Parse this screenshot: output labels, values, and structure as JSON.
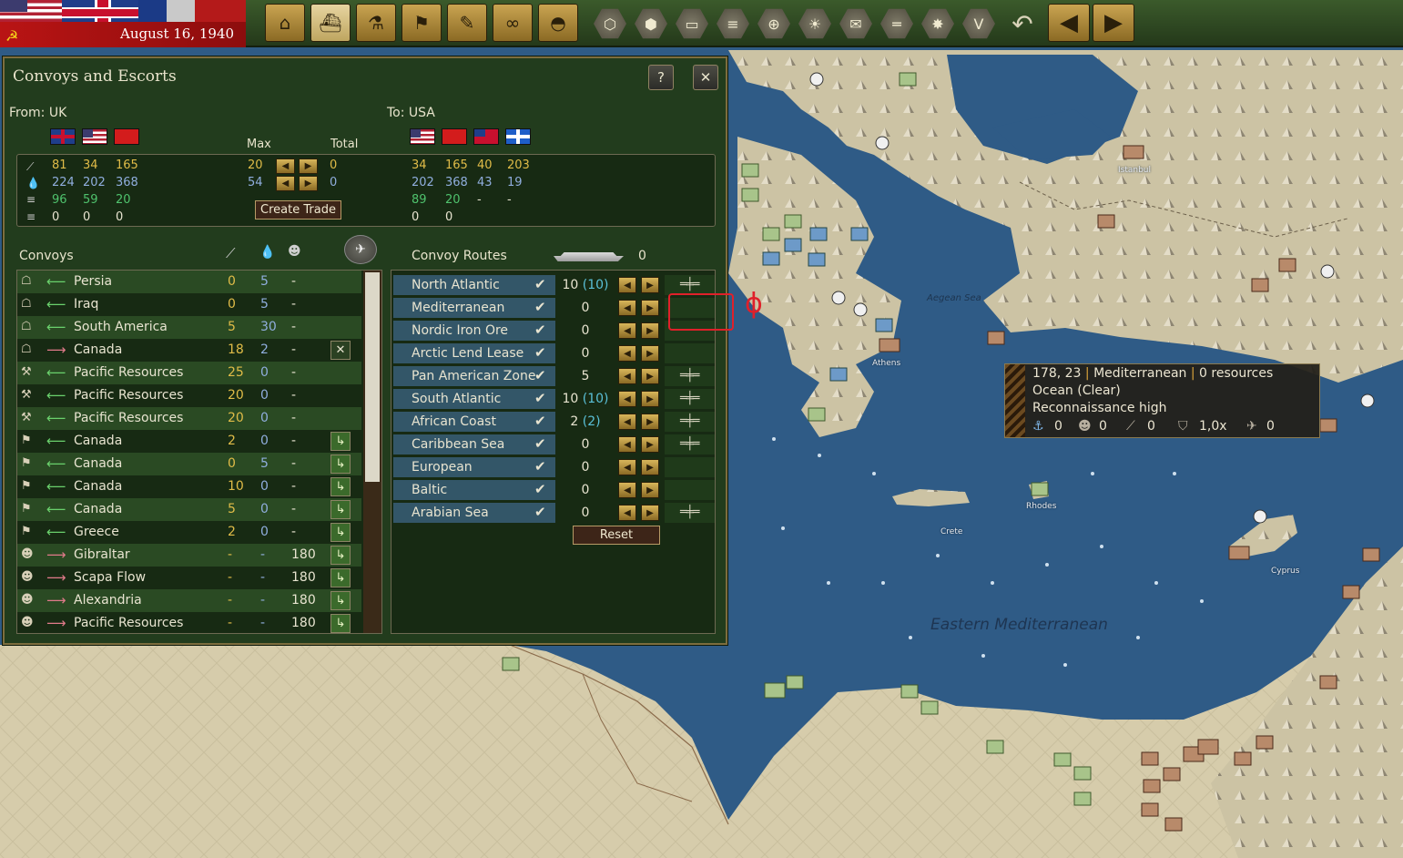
{
  "topbar": {
    "date": "August 16, 1940",
    "buttons": [
      "factory-icon",
      "ship-icon",
      "research-icon",
      "flag-icon",
      "report-icon",
      "binoculars-icon",
      "helmet-icon"
    ],
    "hex_buttons": [
      "hex-grid-icon",
      "hex-cluster-icon",
      "tank-icon",
      "supply-icon",
      "target-icon",
      "sun-icon",
      "mail-icon",
      "convoy-icon",
      "explosion-icon"
    ],
    "v_label": "V",
    "undo_icon": "↶",
    "prev_icon": "◀",
    "next_icon": "▶"
  },
  "dialog": {
    "title": "Convoys and Escorts",
    "help_label": "?",
    "close_label": "✕",
    "from_label": "From: UK",
    "to_label": "To: USA",
    "max_label": "Max",
    "total_label": "Total",
    "create_trade_label": "Create Trade",
    "trade": {
      "from_rows": [
        [
          "81",
          "34",
          "165"
        ],
        [
          "224",
          "202",
          "368"
        ],
        [
          "96",
          "59",
          "20"
        ],
        [
          "0",
          "0",
          "0"
        ]
      ],
      "max": [
        "20",
        "54"
      ],
      "total": [
        "0",
        "0"
      ],
      "to_rows": [
        [
          "34",
          "165",
          "40",
          "203"
        ],
        [
          "202",
          "368",
          "43",
          "19"
        ],
        [
          "89",
          "20",
          "-",
          "-"
        ],
        [
          "0",
          "0",
          "",
          ""
        ]
      ]
    },
    "convoys_label": "Convoys",
    "convoy_routes_label": "Convoy Routes",
    "convoy_routes_count": "0",
    "convoys": [
      {
        "icon": "trade",
        "dir": "left",
        "name": "Persia",
        "c1": "0",
        "c2": "5",
        "c3": "-",
        "action": ""
      },
      {
        "icon": "trade",
        "dir": "left",
        "name": "Iraq",
        "c1": "0",
        "c2": "5",
        "c3": "-",
        "action": ""
      },
      {
        "icon": "trade",
        "dir": "left",
        "name": "South America",
        "c1": "5",
        "c2": "30",
        "c3": "-",
        "action": ""
      },
      {
        "icon": "trade",
        "dir": "right",
        "name": "Canada",
        "c1": "18",
        "c2": "2",
        "c3": "-",
        "action": "✕"
      },
      {
        "icon": "tools",
        "dir": "left",
        "name": "Pacific Resources",
        "c1": "25",
        "c2": "0",
        "c3": "-",
        "action": ""
      },
      {
        "icon": "tools",
        "dir": "left",
        "name": "Pacific Resources",
        "c1": "20",
        "c2": "0",
        "c3": "-",
        "action": ""
      },
      {
        "icon": "tools",
        "dir": "left",
        "name": "Pacific Resources",
        "c1": "20",
        "c2": "0",
        "c3": "-",
        "action": ""
      },
      {
        "icon": "flag",
        "dir": "left",
        "name": "Canada",
        "c1": "2",
        "c2": "0",
        "c3": "-",
        "action": "↳"
      },
      {
        "icon": "flag",
        "dir": "left",
        "name": "Canada",
        "c1": "0",
        "c2": "5",
        "c3": "-",
        "action": "↳"
      },
      {
        "icon": "flag",
        "dir": "left",
        "name": "Canada",
        "c1": "10",
        "c2": "0",
        "c3": "-",
        "action": "↳"
      },
      {
        "icon": "flag",
        "dir": "left",
        "name": "Canada",
        "c1": "5",
        "c2": "0",
        "c3": "-",
        "action": "↳"
      },
      {
        "icon": "flag",
        "dir": "left",
        "name": "Greece",
        "c1": "2",
        "c2": "0",
        "c3": "-",
        "action": "↳"
      },
      {
        "icon": "soldier",
        "dir": "right",
        "name": "Gibraltar",
        "c1": "-",
        "c2": "-",
        "c3": "180",
        "action": "↳"
      },
      {
        "icon": "soldier",
        "dir": "right",
        "name": "Scapa Flow",
        "c1": "-",
        "c2": "-",
        "c3": "180",
        "action": "↳"
      },
      {
        "icon": "soldier",
        "dir": "right",
        "name": "Alexandria",
        "c1": "-",
        "c2": "-",
        "c3": "180",
        "action": "↳"
      },
      {
        "icon": "soldier",
        "dir": "right",
        "name": "Pacific Resources",
        "c1": "-",
        "c2": "-",
        "c3": "180",
        "action": "↳"
      }
    ],
    "routes": [
      {
        "name": "North Atlantic",
        "value": "10",
        "paren": "(10)",
        "convoy": true
      },
      {
        "name": "Mediterranean",
        "value": "0",
        "paren": "",
        "convoy": false
      },
      {
        "name": "Nordic Iron Ore",
        "value": "0",
        "paren": "",
        "convoy": false
      },
      {
        "name": "Arctic Lend Lease",
        "value": "0",
        "paren": "",
        "convoy": false
      },
      {
        "name": "Pan American Zone",
        "value": "5",
        "paren": "",
        "convoy": true
      },
      {
        "name": "South Atlantic",
        "value": "10",
        "paren": "(10)",
        "convoy": true
      },
      {
        "name": "African Coast",
        "value": "2",
        "paren": "(2)",
        "convoy": true
      },
      {
        "name": "Caribbean Sea",
        "value": "0",
        "paren": "",
        "convoy": true
      },
      {
        "name": "European",
        "value": "0",
        "paren": "",
        "convoy": false
      },
      {
        "name": "Baltic",
        "value": "0",
        "paren": "",
        "convoy": false
      },
      {
        "name": "Arabian Sea",
        "value": "0",
        "paren": "",
        "convoy": true
      }
    ],
    "reset_label": "Reset"
  },
  "tooltip": {
    "coords": "178, 23",
    "sep": "|",
    "region": "Mediterranean",
    "resources": "0 resources",
    "terrain": "Ocean (Clear)",
    "recon": "Reconnaissance high",
    "stats": [
      "0",
      "0",
      "0",
      "1,0x",
      "0"
    ]
  },
  "map": {
    "aegean_label": "Aegean Sea",
    "east_med_label": "Eastern Mediterranean",
    "towns": [
      "Rhodes",
      "Crete",
      "Cyprus",
      "Istanbul",
      "Athens"
    ]
  },
  "markup": {
    "phi": "ϕ"
  }
}
